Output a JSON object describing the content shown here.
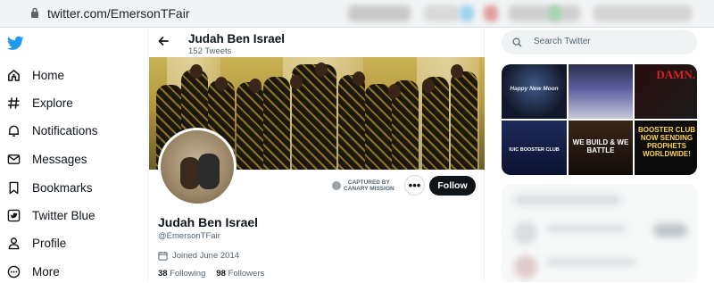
{
  "browser": {
    "url": "twitter.com/EmersonTFair"
  },
  "nav": {
    "items": [
      {
        "label": "Home",
        "icon": "home-icon"
      },
      {
        "label": "Explore",
        "icon": "hashtag-icon"
      },
      {
        "label": "Notifications",
        "icon": "bell-icon"
      },
      {
        "label": "Messages",
        "icon": "envelope-icon"
      },
      {
        "label": "Bookmarks",
        "icon": "bookmark-icon"
      },
      {
        "label": "Twitter Blue",
        "icon": "twitter-blue-icon"
      },
      {
        "label": "Profile",
        "icon": "person-icon"
      },
      {
        "label": "More",
        "icon": "more-circle-icon"
      }
    ]
  },
  "header": {
    "name": "Judah Ben Israel",
    "tweets": "152 Tweets"
  },
  "profile": {
    "name": "Judah Ben Israel",
    "handle": "@EmersonTFair",
    "joined": "Joined June 2014",
    "following_count": "38",
    "following_label": "Following",
    "followers_count": "98",
    "followers_label": "Followers",
    "follow_label": "Follow",
    "more_label": "•••"
  },
  "stamp": {
    "line1": "CAPTURED BY",
    "line2": "CANARY MISSION"
  },
  "search": {
    "placeholder": "Search Twitter"
  },
  "media": {
    "tiles": [
      {
        "text": "Happy New Moon"
      },
      {
        "text": ""
      },
      {
        "text": "DAMN."
      },
      {
        "text": "IUIC BOOSTER CLUB"
      },
      {
        "text": "WE BUILD & WE BATTLE"
      },
      {
        "text": "BOOSTER CLUB NOW SENDING PROPHETS WORLDWIDE!"
      }
    ]
  },
  "colors": {
    "accent": "#1d9bf0",
    "text": "#0f1419",
    "muted": "#536471",
    "follow_bg": "#0f1419"
  }
}
